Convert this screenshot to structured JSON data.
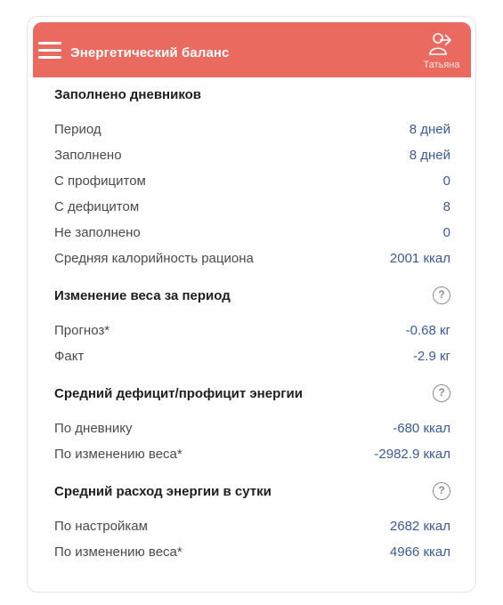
{
  "header": {
    "title": "Энергетический баланс",
    "user_name": "Татьяна",
    "menu_icon": "hamburger-menu-icon",
    "user_icon": "user-profile-icon",
    "accent_color": "#ea6a60"
  },
  "sections": [
    {
      "title": "Заполнено дневников",
      "has_help": false,
      "rows": [
        {
          "label": "Период",
          "value": "8 дней"
        },
        {
          "label": "Заполнено",
          "value": "8 дней"
        },
        {
          "label": "С профицитом",
          "value": "0"
        },
        {
          "label": "С дефицитом",
          "value": "8"
        },
        {
          "label": "Не заполнено",
          "value": "0"
        },
        {
          "label": "Средняя калорийность рациона",
          "value": "2001 ккал"
        }
      ]
    },
    {
      "title": "Изменение веса за период",
      "has_help": true,
      "help_glyph": "?",
      "rows": [
        {
          "label": "Прогноз*",
          "value": "-0.68 кг"
        },
        {
          "label": "Факт",
          "value": "-2.9 кг"
        }
      ]
    },
    {
      "title": "Средний дефицит/профицит энергии",
      "has_help": true,
      "help_glyph": "?",
      "rows": [
        {
          "label": "По дневнику",
          "value": "-680 ккал"
        },
        {
          "label": "По изменению веса*",
          "value": "-2982.9 ккал"
        }
      ]
    },
    {
      "title": "Средний расход энергии в сутки",
      "has_help": true,
      "help_glyph": "?",
      "rows": [
        {
          "label": "По настройкам",
          "value": "2682 ккал"
        },
        {
          "label": "По изменению веса*",
          "value": "4966 ккал"
        }
      ]
    }
  ]
}
